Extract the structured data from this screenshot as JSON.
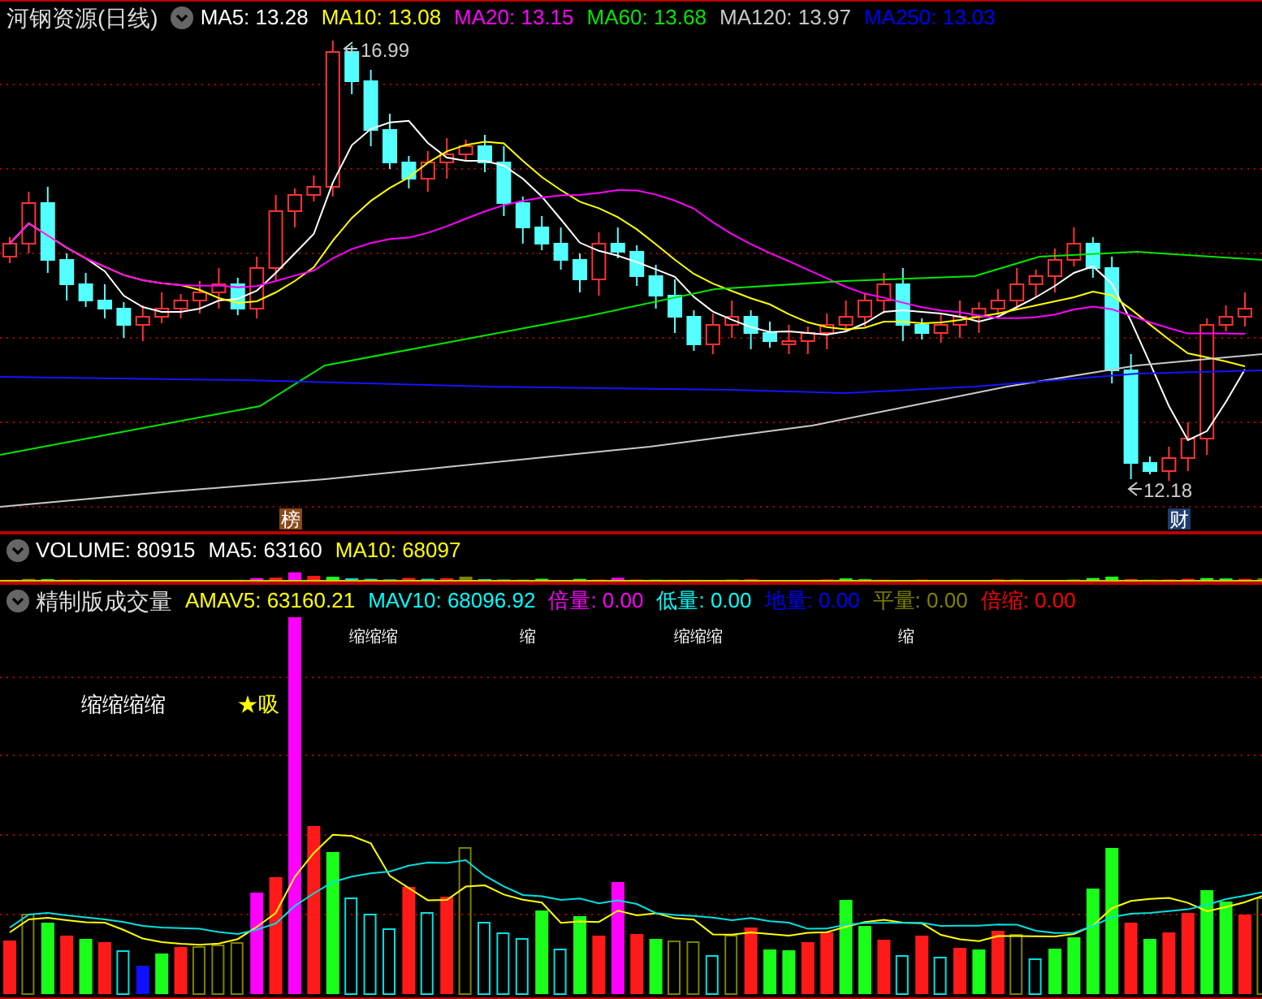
{
  "main_panel": {
    "title": "河钢资源(日线)",
    "legend": [
      {
        "label": "MA5: 13.28",
        "color": "#ffffff"
      },
      {
        "label": "MA10: 13.08",
        "color": "#ffff00"
      },
      {
        "label": "MA20: 13.15",
        "color": "#ff00ff"
      },
      {
        "label": "MA60: 13.68",
        "color": "#00e600"
      },
      {
        "label": "MA120: 13.97",
        "color": "#c8c8c8"
      },
      {
        "label": "MA250: 13.03",
        "color": "#0000ff"
      }
    ],
    "high_label": "16.99",
    "low_label": "12.18",
    "badges": [
      {
        "text": "榜",
        "color": "#8a4a1a"
      },
      {
        "text": "财",
        "color": "#1d3d6e"
      }
    ]
  },
  "volume_panel": {
    "legend": [
      {
        "label": "VOLUME: 80915",
        "color": "#ffffff"
      },
      {
        "label": "MA5: 63160",
        "color": "#ffffff"
      },
      {
        "label": "MA10: 68097",
        "color": "#ffff00"
      }
    ]
  },
  "indicator_panel": {
    "title": "精制版成交量",
    "legend": [
      {
        "label": "AMAV5: 63160.21",
        "color": "#ffff00"
      },
      {
        "label": "MAV10: 68096.92",
        "color": "#00ffff"
      },
      {
        "label": "倍量: 0.00",
        "color": "#ff00ff"
      },
      {
        "label": "低量: 0.00",
        "color": "#00ffff"
      },
      {
        "label": "地量: 0.00",
        "color": "#0000ff"
      },
      {
        "label": "平量: 0.00",
        "color": "#808000"
      },
      {
        "label": "倍缩: 0.00",
        "color": "#ff0000"
      }
    ],
    "signal_labels": [
      "缩缩缩",
      "缩",
      "缩缩缩",
      "缩"
    ],
    "notes": [
      "缩缩缩缩",
      "★吸"
    ]
  }
}
